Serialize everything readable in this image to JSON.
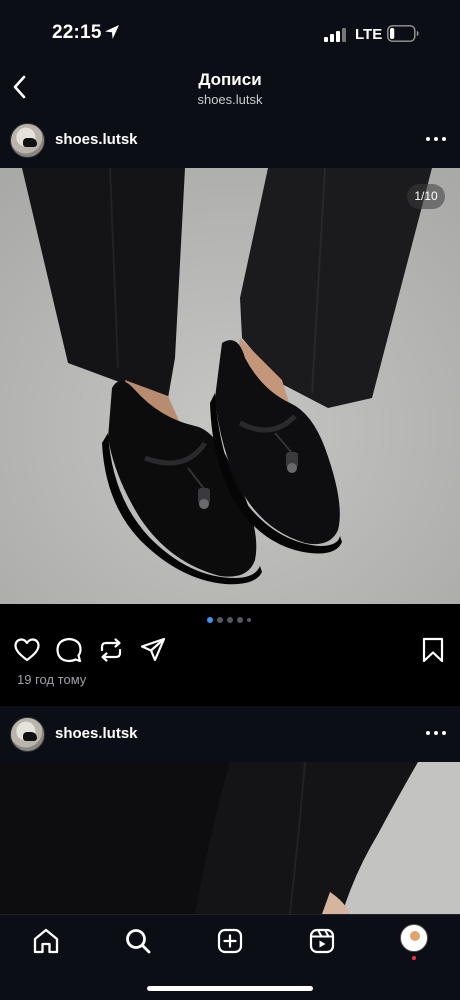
{
  "status_bar": {
    "time": "22:15",
    "network": "LTE",
    "battery_level": 0.1
  },
  "header": {
    "title": "Дописи",
    "subtitle": "shoes.lutsk"
  },
  "posts": [
    {
      "username": "shoes.lutsk",
      "photo_counter": "1/10",
      "carousel_active_index": 0,
      "carousel_dot_count": 5,
      "time_ago": "19 год тому"
    },
    {
      "username": "shoes.lutsk"
    }
  ],
  "icons": {
    "status": [
      "location-arrow-icon",
      "signal-icon",
      "battery-icon"
    ],
    "header": [
      "back-icon"
    ],
    "post": [
      "more-icon",
      "heart-icon",
      "comment-icon",
      "repost-icon",
      "share-icon",
      "bookmark-icon"
    ],
    "tab_bar": [
      "home-icon",
      "search-icon",
      "create-icon",
      "reels-icon",
      "profile-avatar"
    ]
  },
  "colors": {
    "background": "#000000",
    "header_bg": "#0b0e14",
    "accent_dot": "#3897f0",
    "notification": "#ff3040"
  }
}
